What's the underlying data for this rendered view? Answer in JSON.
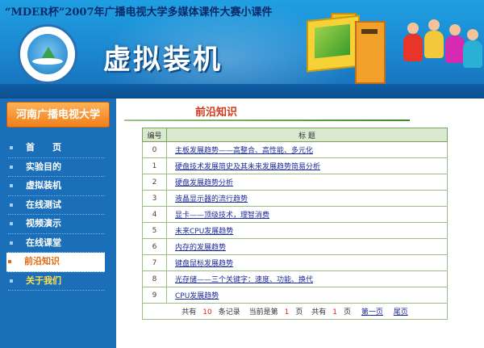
{
  "header": {
    "top_title": "“MDER杯”2007年广播电视大学多媒体课件大赛小课件",
    "main_title": "虚拟装机",
    "logo_icon": "university-logo-icon"
  },
  "sidebar": {
    "university": "河南广播电视大学",
    "items": [
      {
        "label": "首　　页",
        "active": false
      },
      {
        "label": "实验目的",
        "active": false
      },
      {
        "label": "虚拟装机",
        "active": false
      },
      {
        "label": "在线测试",
        "active": false
      },
      {
        "label": "视频演示",
        "active": false
      },
      {
        "label": "在线课堂",
        "active": false
      },
      {
        "label": "前沿知识",
        "active": true
      },
      {
        "label": "关于我们",
        "active": false
      }
    ]
  },
  "main": {
    "section_title": "前沿知识",
    "table": {
      "headers": [
        "编号",
        "标 题"
      ],
      "rows": [
        {
          "num": "0",
          "title": "主板发展趋势——高整合、高性能、多元化"
        },
        {
          "num": "1",
          "title": "硬盘技术发展简史及其未来发展趋势简易分析"
        },
        {
          "num": "2",
          "title": "硬盘发展趋势分析"
        },
        {
          "num": "3",
          "title": "液晶显示器的流行趋势"
        },
        {
          "num": "4",
          "title": "显卡——顶级技术，理智消费"
        },
        {
          "num": "5",
          "title": "未来CPU发展趋势"
        },
        {
          "num": "6",
          "title": "内存的发展趋势"
        },
        {
          "num": "7",
          "title": "键盘鼠标发展趋势"
        },
        {
          "num": "8",
          "title": "光存储——三个关键字：速度、功能、换代"
        },
        {
          "num": "9",
          "title": "CPU发展趋势"
        }
      ]
    },
    "pager": {
      "total_prefix": "共有",
      "total_count": "10",
      "total_suffix": "条记录",
      "current_prefix": "当前是第",
      "current_page": "1",
      "current_suffix": "页",
      "pages_prefix": "共有",
      "pages_count": "1",
      "pages_suffix": "页",
      "first_page": "第一页",
      "last_page": "尾页"
    }
  },
  "colors": {
    "header_blue": "#1b86cf",
    "sidebar_blue": "#1a6fb8",
    "accent_orange": "#f07f1a",
    "section_title_red": "#d4361b",
    "link_blue": "#1c2a9c",
    "table_border_green": "#9bbd83"
  }
}
